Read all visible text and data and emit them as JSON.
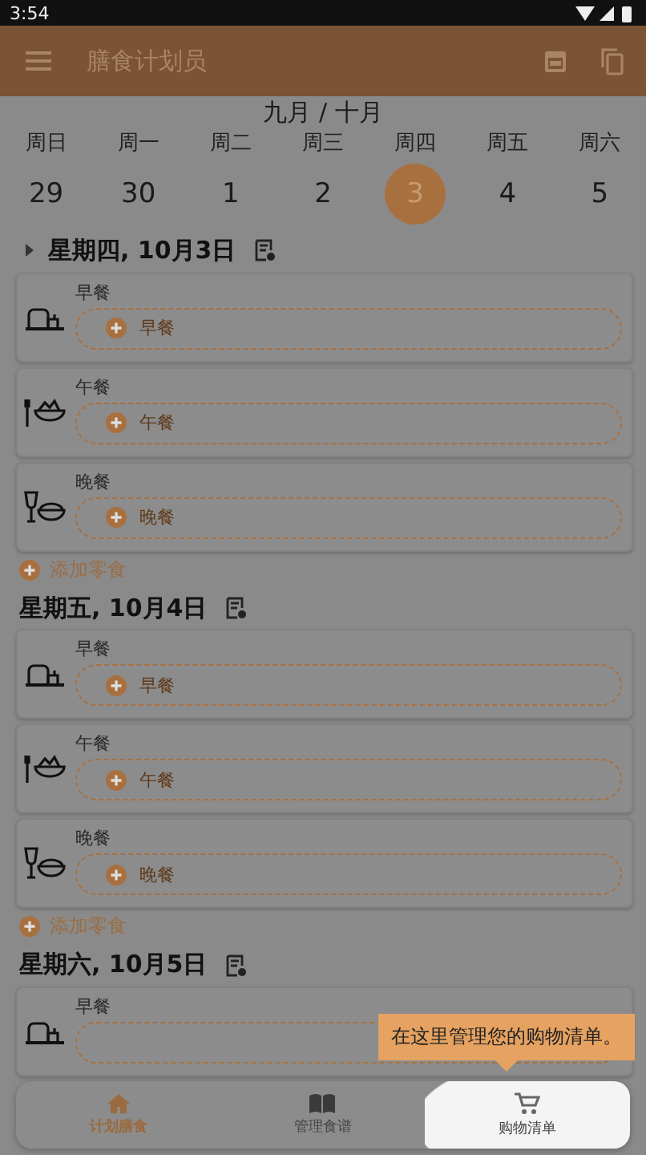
{
  "status_bar": {
    "time": "3:54"
  },
  "app_bar": {
    "title": "膳食计划员"
  },
  "calendar": {
    "month": "九月 / 十月",
    "days": [
      {
        "weekday": "周日",
        "date": "29",
        "selected": false
      },
      {
        "weekday": "周一",
        "date": "30",
        "selected": false
      },
      {
        "weekday": "周二",
        "date": "1",
        "selected": false
      },
      {
        "weekday": "周三",
        "date": "2",
        "selected": false
      },
      {
        "weekday": "周四",
        "date": "3",
        "selected": true
      },
      {
        "weekday": "周五",
        "date": "4",
        "selected": false
      },
      {
        "weekday": "周六",
        "date": "5",
        "selected": false
      }
    ]
  },
  "days": [
    {
      "heading": "星期四, 10月3日",
      "expander": true,
      "add_snack": "添加零食",
      "meals": [
        {
          "kind": "breakfast",
          "label": "早餐",
          "placeholder": "早餐"
        },
        {
          "kind": "lunch",
          "label": "午餐",
          "placeholder": "午餐"
        },
        {
          "kind": "dinner",
          "label": "晚餐",
          "placeholder": "晚餐"
        }
      ]
    },
    {
      "heading": "星期五, 10月4日",
      "expander": false,
      "add_snack": "添加零食",
      "meals": [
        {
          "kind": "breakfast",
          "label": "早餐",
          "placeholder": "早餐"
        },
        {
          "kind": "lunch",
          "label": "午餐",
          "placeholder": "午餐"
        },
        {
          "kind": "dinner",
          "label": "晚餐",
          "placeholder": "晚餐"
        }
      ]
    },
    {
      "heading": "星期六, 10月5日",
      "expander": false,
      "meals": [
        {
          "kind": "breakfast",
          "label": "早餐"
        }
      ]
    }
  ],
  "tooltip": {
    "text": "在这里管理您的购物清单。"
  },
  "bottom_nav": [
    {
      "kind": "home",
      "label": "计划膳食",
      "selected": true,
      "spotlight": false
    },
    {
      "kind": "book",
      "label": "管理食谱",
      "selected": false,
      "spotlight": false
    },
    {
      "kind": "cart",
      "label": "购物清单",
      "selected": false,
      "spotlight": true
    }
  ]
}
